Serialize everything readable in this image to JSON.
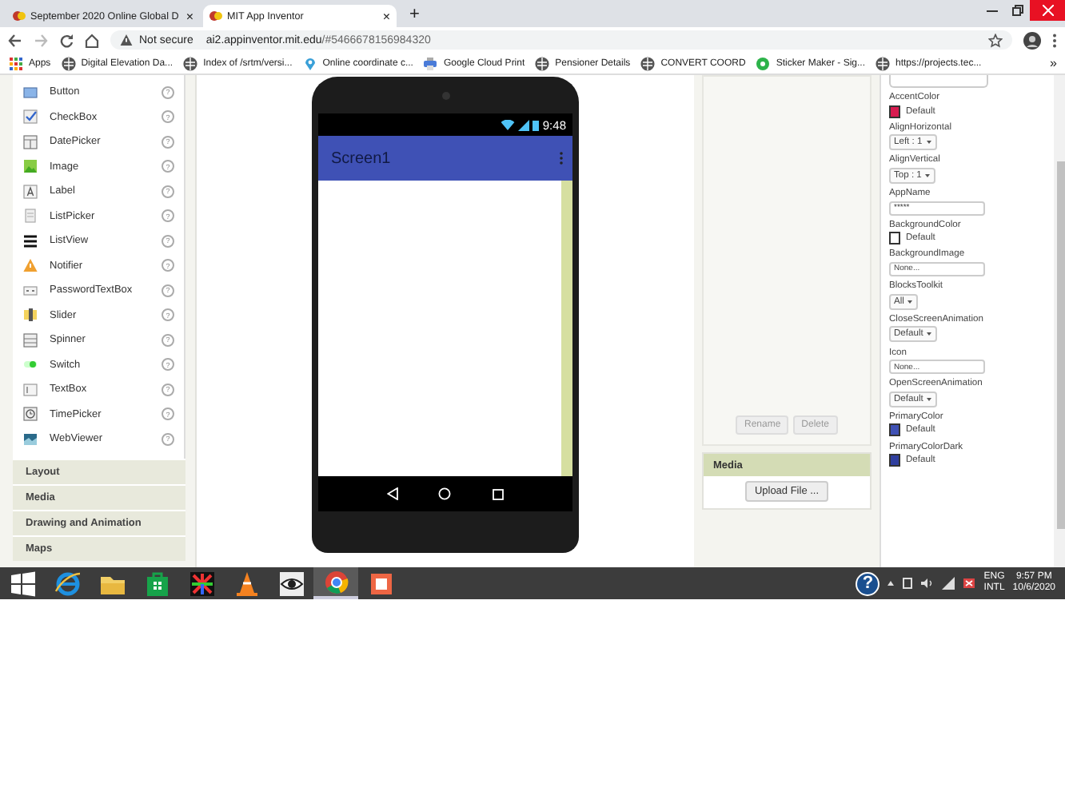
{
  "browser": {
    "tabs": [
      {
        "title": "September 2020 Online Global D",
        "selected": false
      },
      {
        "title": "MIT App Inventor",
        "selected": true
      }
    ],
    "new_tab": "+",
    "tab_close": "×",
    "address": {
      "security": "Not secure",
      "host": "ai2.appinventor.mit.edu",
      "path": "/#5466678156984320"
    },
    "bookmarks": [
      {
        "label": "Apps",
        "kind": "apps"
      },
      {
        "label": "Digital Elevation Da...",
        "kind": "globe"
      },
      {
        "label": "Index of /srtm/versi...",
        "kind": "globe"
      },
      {
        "label": "Online coordinate c...",
        "kind": "pin"
      },
      {
        "label": "Google Cloud Print",
        "kind": "printer"
      },
      {
        "label": "Pensioner Details",
        "kind": "globe"
      },
      {
        "label": "CONVERT COORD",
        "kind": "globe"
      },
      {
        "label": "Sticker Maker - Sig...",
        "kind": "dot"
      },
      {
        "label": "https://projects.tec...",
        "kind": "globe"
      }
    ],
    "more": "»"
  },
  "palette": {
    "items": [
      {
        "label": "Button",
        "kind": "button"
      },
      {
        "label": "CheckBox",
        "kind": "checkbox"
      },
      {
        "label": "DatePicker",
        "kind": "calendar"
      },
      {
        "label": "Image",
        "kind": "image"
      },
      {
        "label": "Label",
        "kind": "label"
      },
      {
        "label": "ListPicker",
        "kind": "list"
      },
      {
        "label": "ListView",
        "kind": "lines"
      },
      {
        "label": "Notifier",
        "kind": "warning"
      },
      {
        "label": "PasswordTextBox",
        "kind": "password"
      },
      {
        "label": "Slider",
        "kind": "slider"
      },
      {
        "label": "Spinner",
        "kind": "spinner"
      },
      {
        "label": "Switch",
        "kind": "switch"
      },
      {
        "label": "TextBox",
        "kind": "textbox"
      },
      {
        "label": "TimePicker",
        "kind": "clock"
      },
      {
        "label": "WebViewer",
        "kind": "web"
      }
    ],
    "help": "?",
    "categories": [
      "Layout",
      "Media",
      "Drawing and Animation",
      "Maps"
    ]
  },
  "phone": {
    "time": "9:48",
    "title": "Screen1"
  },
  "components": {
    "buttons": [
      {
        "label": "Rename",
        "disabled": true
      },
      {
        "label": "Delete",
        "disabled": true
      }
    ],
    "media_header": "Media",
    "upload": "Upload File ..."
  },
  "properties": [
    {
      "kind": "color",
      "label": "AccentColor",
      "value": "Default",
      "color": "#d81b50"
    },
    {
      "kind": "dropdown",
      "label": "AlignHorizontal",
      "value": "Left : 1"
    },
    {
      "kind": "dropdown",
      "label": "AlignVertical",
      "value": "Top : 1"
    },
    {
      "kind": "text",
      "label": "AppName",
      "value": "*****"
    },
    {
      "kind": "color",
      "label": "BackgroundColor",
      "value": "Default",
      "color": "#ffffff"
    },
    {
      "kind": "text",
      "label": "BackgroundImage",
      "value": "None..."
    },
    {
      "kind": "dropdown",
      "label": "BlocksToolkit",
      "value": "All"
    },
    {
      "kind": "dropdown",
      "label": "CloseScreenAnimation",
      "value": "Default"
    },
    {
      "kind": "text",
      "label": "Icon",
      "value": "None..."
    },
    {
      "kind": "dropdown",
      "label": "OpenScreenAnimation",
      "value": "Default"
    },
    {
      "kind": "color",
      "label": "PrimaryColor",
      "value": "Default",
      "color": "#3f51b5"
    },
    {
      "kind": "color",
      "label": "PrimaryColorDark",
      "value": "Default",
      "color": "#303f9f"
    }
  ],
  "taskbar": {
    "apps": [
      {
        "kind": "windows"
      },
      {
        "kind": "ie"
      },
      {
        "kind": "folder"
      },
      {
        "kind": "store"
      },
      {
        "kind": "colors"
      },
      {
        "kind": "cone"
      },
      {
        "kind": "eye"
      },
      {
        "kind": "chrome",
        "selected": true
      },
      {
        "kind": "app",
        "selected": false
      }
    ],
    "help": "?",
    "lang": "ENG",
    "layout": "INTL",
    "time": "9:57 PM",
    "date": "10/6/2020"
  }
}
